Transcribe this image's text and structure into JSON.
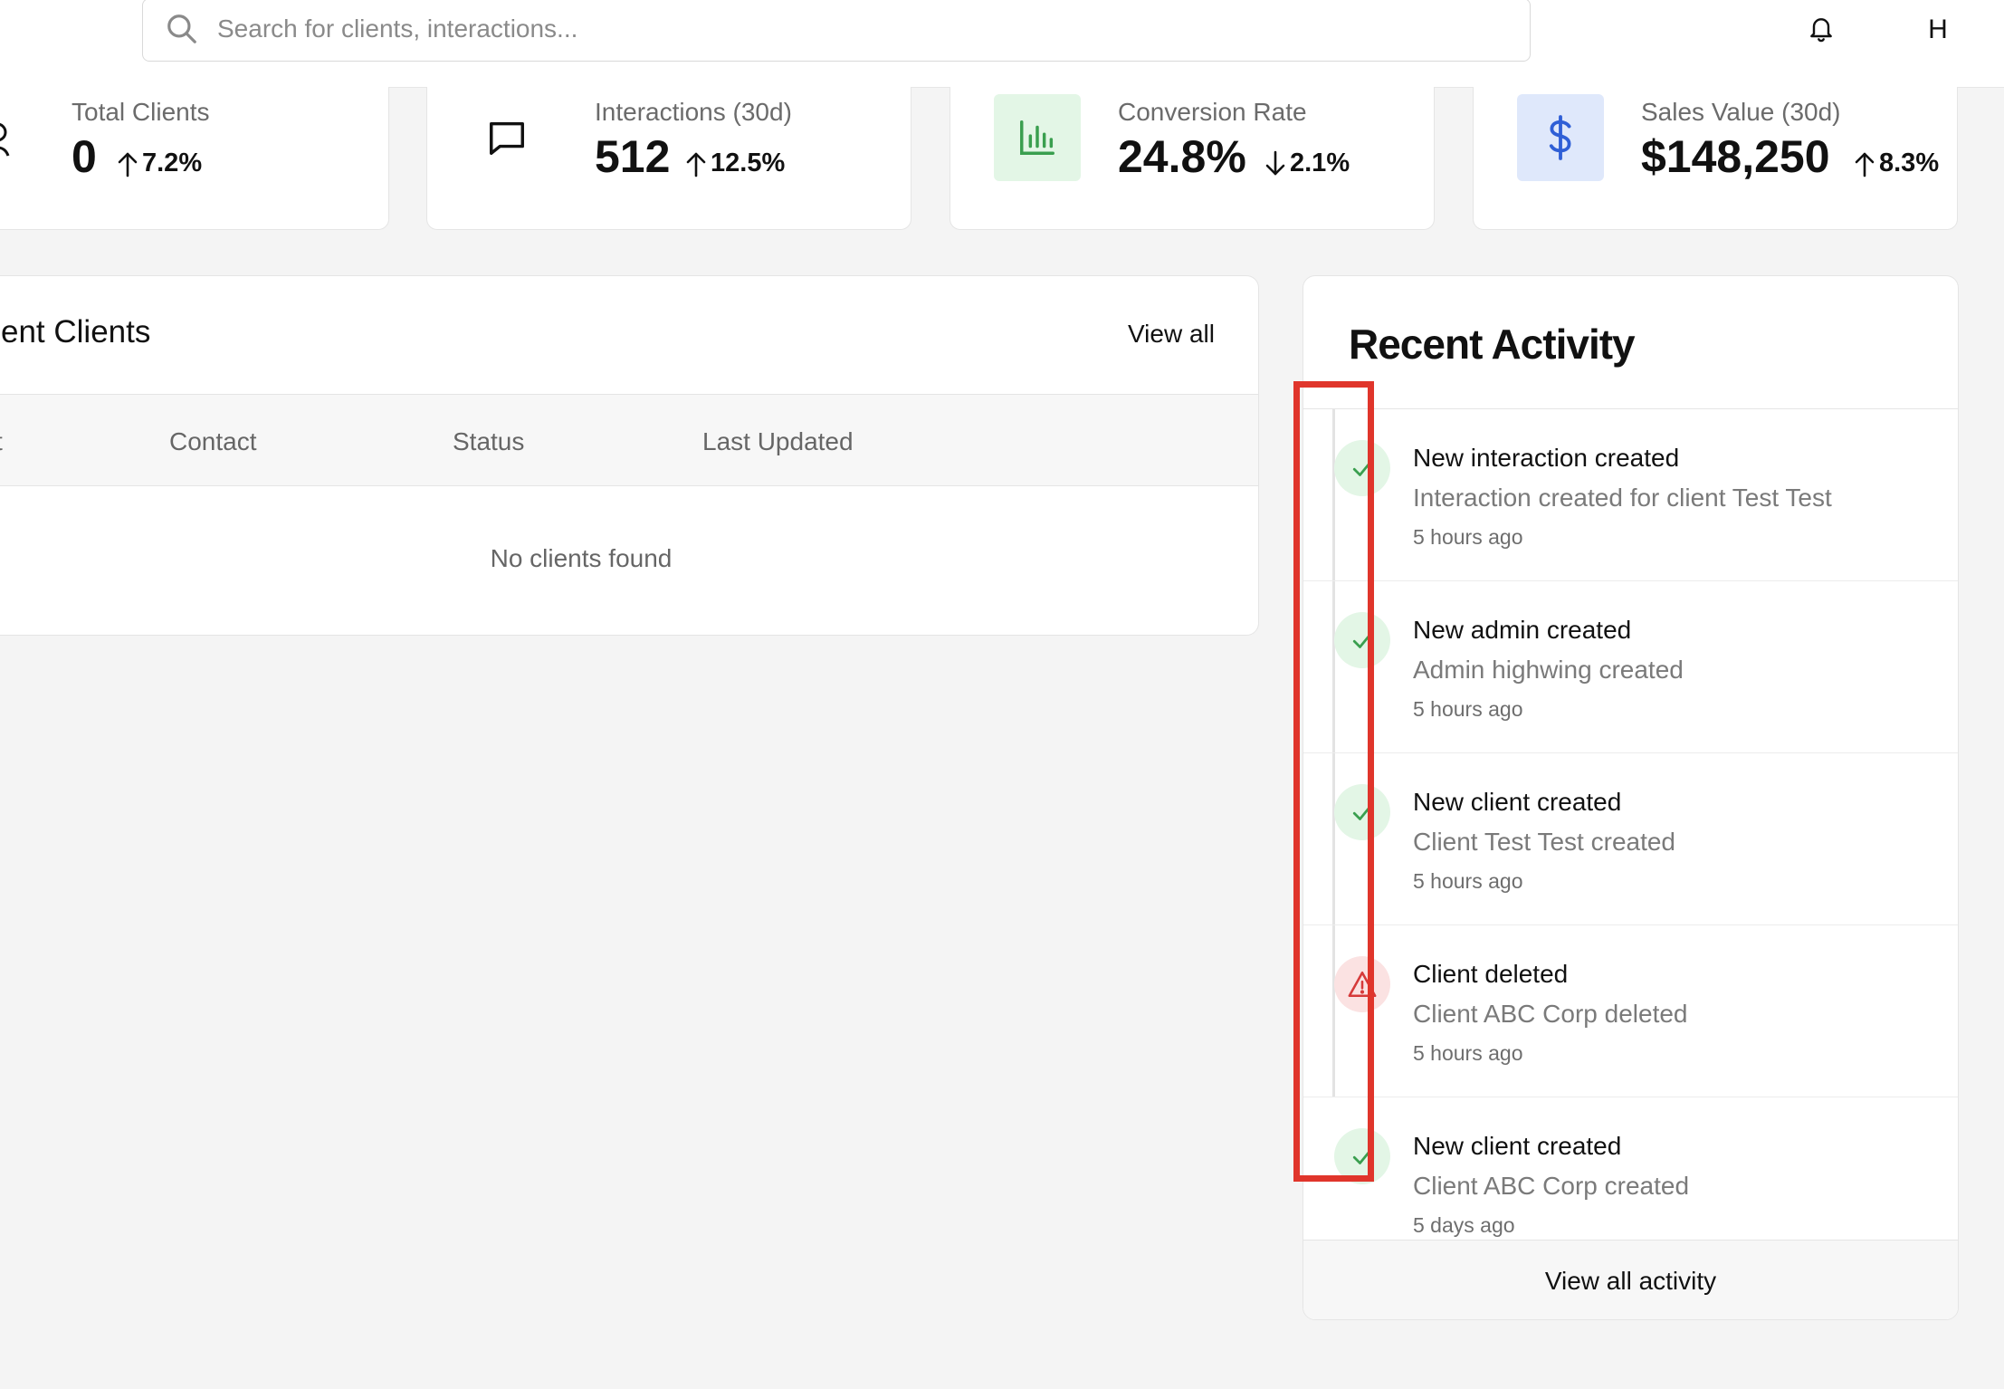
{
  "header": {
    "search_placeholder": "Search for clients, interactions...",
    "avatar_initial": "H",
    "icons": [
      "search-icon",
      "bell-icon"
    ]
  },
  "stats": [
    {
      "label": "Total Clients",
      "value": "0",
      "change": "7.2%",
      "direction": "up",
      "icon": "users-icon"
    },
    {
      "label": "Interactions (30d)",
      "value": "512",
      "change": "12.5%",
      "direction": "up",
      "icon": "message-icon"
    },
    {
      "label": "Conversion Rate",
      "value": "24.8%",
      "change": "2.1%",
      "direction": "down",
      "icon": "bar-chart-icon",
      "icon_bg": "#e3f6e6",
      "icon_color": "#3a9f4f"
    },
    {
      "label": "Sales Value (30d)",
      "value": "$148,250",
      "change": "8.3%",
      "direction": "up",
      "icon": "dollar-icon",
      "icon_bg": "#dfe8fb",
      "icon_color": "#2f5fd6"
    }
  ],
  "recent_clients": {
    "title": "ent Clients",
    "view_all": "View all",
    "columns": [
      "t",
      "Contact",
      "Status",
      "Last Updated"
    ],
    "empty_text": "No clients found"
  },
  "recent_activity": {
    "title": "Recent Activity",
    "items": [
      {
        "title": "New interaction created",
        "description": "Interaction created for client Test Test",
        "time": "5 hours ago",
        "kind": "success"
      },
      {
        "title": "New admin created",
        "description": "Admin highwing created",
        "time": "5 hours ago",
        "kind": "success"
      },
      {
        "title": "New client created",
        "description": "Client Test Test created",
        "time": "5 hours ago",
        "kind": "success"
      },
      {
        "title": "Client deleted",
        "description": "Client ABC Corp deleted",
        "time": "5 hours ago",
        "kind": "warning"
      },
      {
        "title": "New client created",
        "description": "Client ABC Corp created",
        "time": "5 days ago",
        "kind": "success"
      }
    ],
    "footer": "View all activity"
  },
  "colors": {
    "success": "#3a9f4f",
    "warning": "#d63a3a",
    "highlight": "#e0352b"
  }
}
